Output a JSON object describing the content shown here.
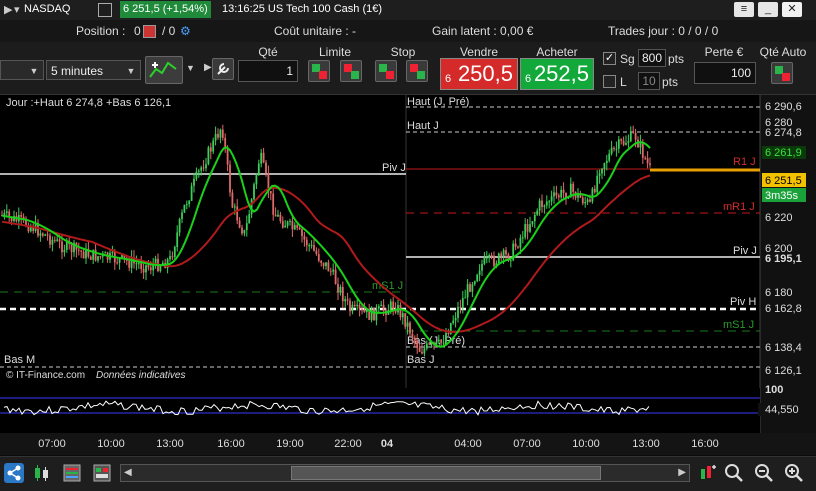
{
  "titlebar": {
    "instrument": "NASDAQ",
    "price_change": "6 251,5 (+1,54%)",
    "time_title": "13:16:25 US Tech 100 Cash (1€)",
    "close_icon": "close-icon"
  },
  "infobar": {
    "position_label": "Position :",
    "position_value": "0",
    "orders_value": "/ 0",
    "unit_cost": "Coût unitaire : -",
    "latent_gain": "Gain latent : 0,00 €",
    "trades_day": "Trades jour : 0 / 0 / 0"
  },
  "toolbar": {
    "timeframe": "5 minutes",
    "qty_header": "Qté",
    "qty_value": "1",
    "limit_header": "Limite",
    "stop_header": "Stop",
    "sell_header": "Vendre",
    "buy_header": "Acheter",
    "sell_small": "6",
    "sell_big": "250,5",
    "buy_small": "6",
    "buy_big": "252,5",
    "sg_label": "Sg",
    "sg_value": "800",
    "pts1": "pts",
    "l_label": "L",
    "l_value": "10",
    "pts2": "pts",
    "loss_header": "Perte €",
    "loss_value": "100",
    "qty_auto_header": "Qté Auto"
  },
  "chart": {
    "header": "Jour :+Haut 6 274,8 +Bas 6 126,1",
    "copyright": "© IT-Finance.com",
    "data_note": "Données indicatives",
    "levels": {
      "haut_pre": "Haut (J, Pré)",
      "haut_j": "Haut J",
      "piv_j_left": "Piv J",
      "r1j": "R1 J",
      "mr1j": "mR1 J",
      "piv_j_right": "Piv J",
      "ms1j_left": "mS1 J",
      "piv_h": "Piv H",
      "ms1j_right": "mS1 J",
      "bas_pre": "Bas (J, Pré)",
      "bas_m": "Bas M",
      "bas_j": "Bas J"
    },
    "price_axis": [
      "6 290,6",
      "6 280",
      "6 274,8",
      "6 261,9",
      "6 251,5",
      "6 220",
      "6 200",
      "6 195,1",
      "6 180",
      "6 162,8",
      "6 138,4",
      "6 126,1"
    ],
    "countdown": "3m35s",
    "time_axis": [
      "07:00",
      "10:00",
      "13:00",
      "16:00",
      "19:00",
      "22:00",
      "04",
      "04:00",
      "07:00",
      "10:00",
      "13:00",
      "16:00"
    ],
    "osc_top": "100",
    "osc_value": "44,550",
    "colors": {
      "green_ma": "#19d119",
      "red_ma": "#b01a1a",
      "current_price": "#e8c000",
      "buy": "#12a83a",
      "sell": "#d42a2a"
    }
  }
}
